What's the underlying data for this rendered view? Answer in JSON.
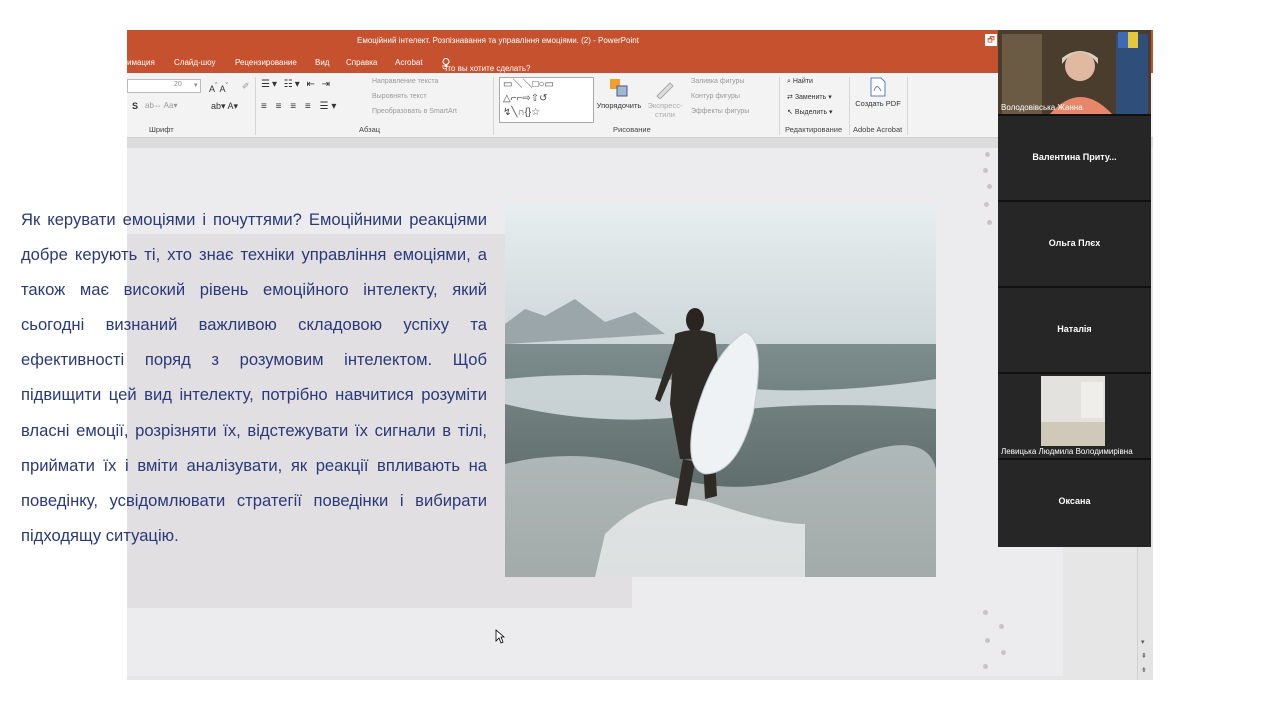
{
  "window": {
    "title": "Емоційний інтелект. Розпізнавання та управління емоціями. (2)  -  PowerPoint"
  },
  "menu": {
    "tabs": [
      "имация",
      "Слайд-шоу",
      "Рецензирование",
      "Вид",
      "Справка",
      "Acrobat"
    ],
    "tell_me": "Что вы хотите сделать?"
  },
  "ribbon": {
    "font_size": "20",
    "groups": {
      "font": "Шрифт",
      "paragraph": "Абзац",
      "drawing": "Рисование",
      "editing": "Редактирование",
      "acrobat": "Adobe Acrobat"
    },
    "paragraph_items": [
      "Направление текста",
      "Выровнять текст",
      "Преобразовать в SmartArt"
    ],
    "arrange_label": "Упорядочить",
    "quick_styles_label": "Экспресс-стили",
    "shape_fill": "Заливка фигуры",
    "shape_outline": "Контур фигуры",
    "shape_effects": "Эффекты фигуры",
    "find": "Найти",
    "replace": "Заменить",
    "select": "Выделить",
    "create_pdf": "Создать PDF"
  },
  "slide": {
    "body_text": "Як керувати емоціями і почуттями? Емоційними реакціями добре керують ті, хто знає техніки управління емоціями, а також має високий рівень емоційного інтелекту, який сьогодні визнаний важливою складовою успіху та ефективності поряд з розумовим інтелектом. Щоб підвищити цей вид інтелекту, потрібно навчитися розуміти власні емоції, розрізняти їх, відстежувати їх сигнали в тілі, приймати їх і вміти аналізувати, як реакції впливають на поведінку, усвідомлювати стратегії поведінки і вибирати підходящу ситуацію."
  },
  "participants": [
    {
      "name": "Володовівська Жанна",
      "video": true
    },
    {
      "name": "Валентина Приту...",
      "video": false
    },
    {
      "name": "Ольга Плєх",
      "video": false
    },
    {
      "name": "Наталія",
      "video": false
    },
    {
      "name": "Левицька Людмила Володимирівна",
      "video": true
    },
    {
      "name": "Оксана",
      "video": false
    }
  ],
  "colors": {
    "titlebar": "#c5512f",
    "slide_text": "#2a3a78",
    "tile_bg": "#262626"
  }
}
